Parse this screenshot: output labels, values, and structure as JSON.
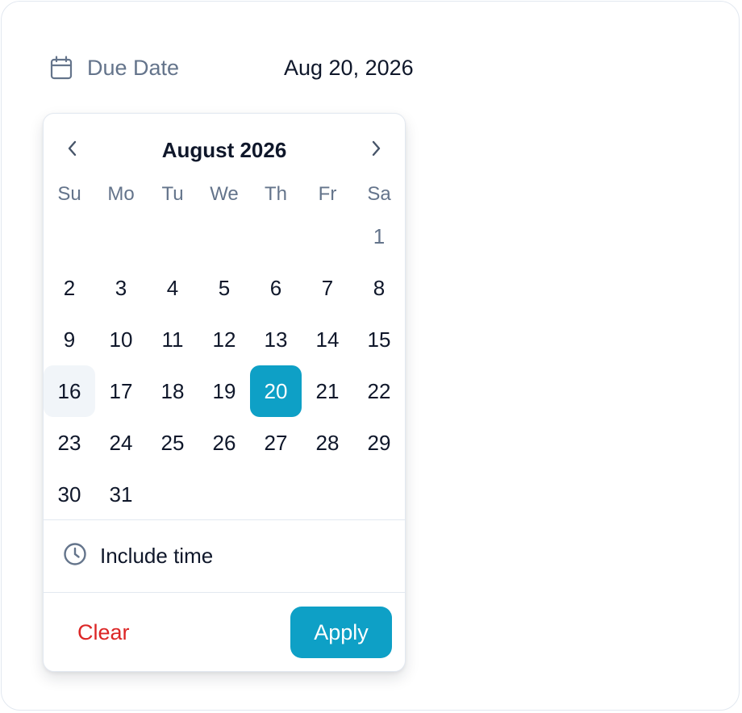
{
  "field": {
    "icon": "calendar-icon",
    "label": "Due Date",
    "value": "Aug 20, 2026"
  },
  "calendar": {
    "month_title": "August 2026",
    "prev_icon": "chevron-left-icon",
    "next_icon": "chevron-right-icon",
    "weekdays": [
      "Su",
      "Mo",
      "Tu",
      "We",
      "Th",
      "Fr",
      "Sa"
    ],
    "leading_blanks": 6,
    "days": [
      "1",
      "2",
      "3",
      "4",
      "5",
      "6",
      "7",
      "8",
      "9",
      "10",
      "11",
      "12",
      "13",
      "14",
      "15",
      "16",
      "17",
      "18",
      "19",
      "20",
      "21",
      "22",
      "23",
      "24",
      "25",
      "26",
      "27",
      "28",
      "29",
      "30",
      "31"
    ],
    "today": "16",
    "selected": "20",
    "colors": {
      "accent": "#0ea0c6",
      "muted": "#64748b",
      "today_bg": "#f1f5f9",
      "danger": "#dc2626"
    }
  },
  "time": {
    "icon": "clock-icon",
    "label": "Include time"
  },
  "actions": {
    "clear_label": "Clear",
    "apply_label": "Apply"
  }
}
